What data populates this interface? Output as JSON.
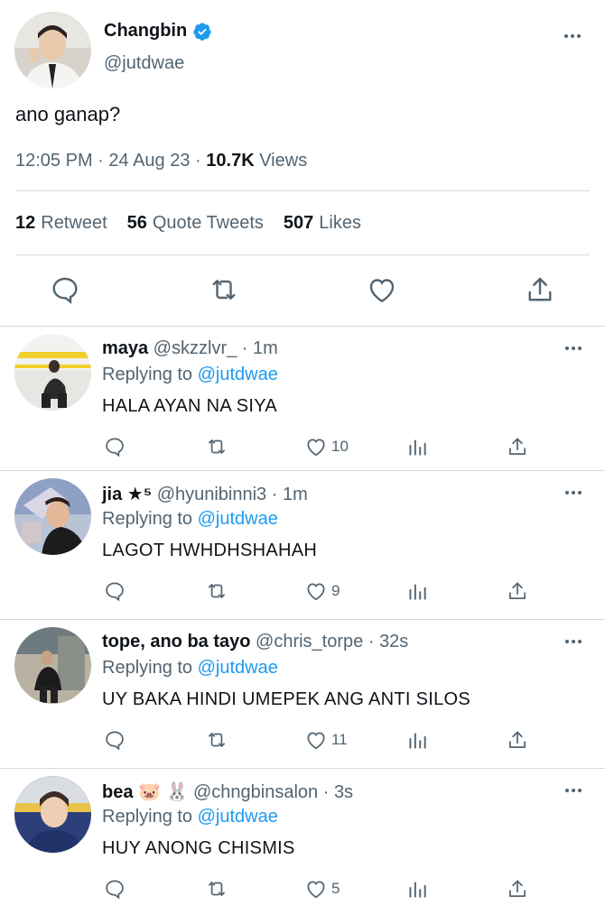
{
  "tweet": {
    "display_name": "Changbin",
    "handle": "@jutdwae",
    "text": "ano ganap?",
    "time": "12:05 PM",
    "date": "24 Aug 23",
    "views_count": "10.7K",
    "views_label": "Views",
    "stats": {
      "retweets_count": "12",
      "retweets_label": "Retweet",
      "quotes_count": "56",
      "quotes_label": "Quote Tweets",
      "likes_count": "507",
      "likes_label": "Likes"
    },
    "icons": [
      "reply-icon",
      "retweet-icon",
      "like-icon",
      "share-icon"
    ]
  },
  "replies": [
    {
      "name": "maya",
      "badge": "",
      "handle": "@skzzlvr_",
      "time": "1m",
      "replying_label": "Replying to",
      "replying_to": "@jutdwae",
      "text": "HALA AYAN NA SIYA",
      "likes": "10"
    },
    {
      "name": "jia ★⁵",
      "badge": "",
      "handle": "@hyunibinni3",
      "time": "1m",
      "replying_label": "Replying to",
      "replying_to": "@jutdwae",
      "text": "LAGOT HWHDHSHAHAH",
      "likes": "9"
    },
    {
      "name": "tope, ano ba tayo",
      "badge": "",
      "handle": "@chris_torpe",
      "time": "32s",
      "replying_label": "Replying to",
      "replying_to": "@jutdwae",
      "text": "UY BAKA HINDI UMEPEK ANG ANTI SILOS",
      "likes": "11"
    },
    {
      "name": "bea",
      "badge": "🐷 🐰",
      "handle": "@chngbinsalon",
      "time": "3s",
      "replying_label": "Replying to",
      "replying_to": "@jutdwae",
      "text": "HUY ANONG CHISMIS",
      "likes": "5"
    }
  ],
  "colors": {
    "accent": "#1d9bf0",
    "muted": "#536471",
    "text": "#0f1419",
    "divider": "#cfd9de"
  }
}
